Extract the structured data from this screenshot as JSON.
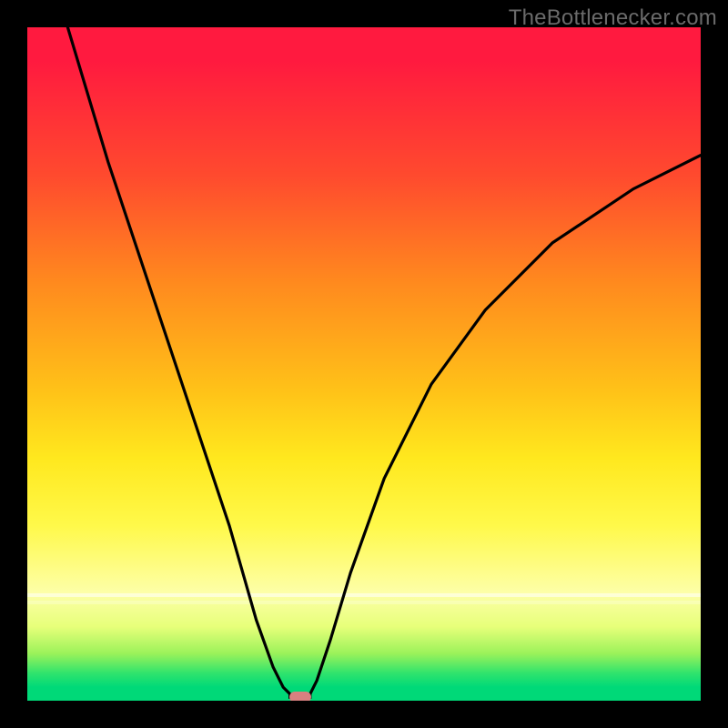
{
  "attribution": "TheBottlenecker.com",
  "chart_data": {
    "type": "line",
    "title": "",
    "xlabel": "",
    "ylabel": "",
    "ylim": [
      0,
      100
    ],
    "xlim": [
      0,
      100
    ],
    "curve_points_left": [
      {
        "x": 6,
        "y": 100
      },
      {
        "x": 12,
        "y": 80
      },
      {
        "x": 18,
        "y": 62
      },
      {
        "x": 24,
        "y": 44
      },
      {
        "x": 30,
        "y": 26
      },
      {
        "x": 34,
        "y": 12
      },
      {
        "x": 36.5,
        "y": 5
      },
      {
        "x": 38,
        "y": 2
      },
      {
        "x": 39,
        "y": 1
      }
    ],
    "curve_points_right": [
      {
        "x": 42,
        "y": 1
      },
      {
        "x": 43,
        "y": 3
      },
      {
        "x": 45,
        "y": 9
      },
      {
        "x": 48,
        "y": 19
      },
      {
        "x": 53,
        "y": 33
      },
      {
        "x": 60,
        "y": 47
      },
      {
        "x": 68,
        "y": 58
      },
      {
        "x": 78,
        "y": 68
      },
      {
        "x": 90,
        "y": 76
      },
      {
        "x": 100,
        "y": 81
      }
    ],
    "minimum_marker": {
      "x": 40.5,
      "y": 0.5
    },
    "gradient_stops": [
      {
        "pos": 0,
        "color": "#ff1a3f"
      },
      {
        "pos": 50,
        "color": "#ffe81e"
      },
      {
        "pos": 100,
        "color": "#00d978"
      }
    ]
  }
}
